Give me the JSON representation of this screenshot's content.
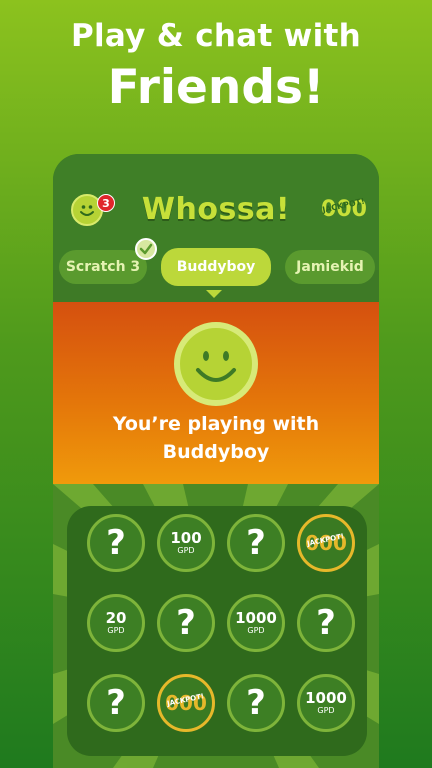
{
  "promo": {
    "line1": "Play & chat with",
    "line2": "Friends!"
  },
  "header": {
    "notification_count": "3",
    "logo": "Whossa!",
    "jackpot_icon_label": "JACKPOT!"
  },
  "tabs": [
    {
      "label": "Scratch 3",
      "checked": true
    },
    {
      "label": "Buddyboy",
      "active": true
    },
    {
      "label": "Jamiekid"
    }
  ],
  "banner": {
    "line1": "You’re playing with",
    "line2": "Buddyboy"
  },
  "grid": {
    "rows": [
      [
        {
          "type": "question",
          "text": "?"
        },
        {
          "type": "amount",
          "amount": "100",
          "unit": "GPD"
        },
        {
          "type": "question",
          "text": "?"
        },
        {
          "type": "jackpot",
          "label": "JACKPOT!"
        }
      ],
      [
        {
          "type": "amount",
          "amount": "20",
          "unit": "GPD"
        },
        {
          "type": "question",
          "text": "?"
        },
        {
          "type": "amount",
          "amount": "1000",
          "unit": "GPD"
        },
        {
          "type": "question",
          "text": "?"
        }
      ],
      [
        {
          "type": "question",
          "text": "?"
        },
        {
          "type": "jackpot",
          "label": "JACKPOT!"
        },
        {
          "type": "question",
          "text": "?"
        },
        {
          "type": "amount",
          "amount": "1000",
          "unit": "GPD"
        }
      ]
    ]
  },
  "colors": {
    "accent": "#bcd83a",
    "banner_top": "#d5500f",
    "banner_bottom": "#f09a0b",
    "badge": "#e0262b"
  }
}
